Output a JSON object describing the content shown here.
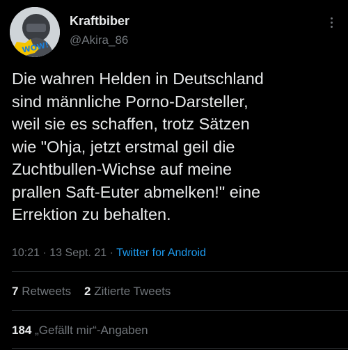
{
  "author": {
    "name": "Kraftbiber",
    "handle": "@Akira_86",
    "avatar_icon": "avatar-image",
    "avatar_sticker_text": "WOW!"
  },
  "menu": {
    "icon": "more-vertical-icon"
  },
  "tweet": {
    "text": "Die wahren Helden in Deutschland\nsind männliche Porno-Darsteller,\nweil sie es schaffen, trotz Sätzen\nwie \"Ohja, jetzt erstmal geil die\nZuchtbullen-Wichse auf meine\nprallen Saft-Euter abmelken!\" eine\nErrektion zu behalten."
  },
  "meta": {
    "time": "10:21",
    "separator": "·",
    "date": "13 Sept. 21",
    "source": "Twitter for Android"
  },
  "stats": {
    "retweets_count": "7",
    "retweets_label": "Retweets",
    "quotes_count": "2",
    "quotes_label": "Zitierte Tweets",
    "likes_count": "184",
    "likes_label": "„Gefällt mir“-Angaben"
  },
  "colors": {
    "background": "#000000",
    "text": "#e7e9ea",
    "secondary": "#71767b",
    "link": "#1d9bf0",
    "divider": "#2f3336"
  }
}
